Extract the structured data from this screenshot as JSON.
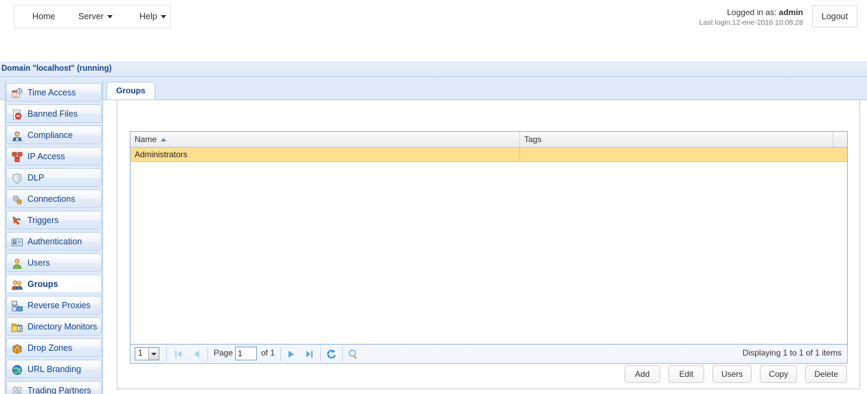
{
  "topnav": {
    "items": [
      {
        "label": "Home",
        "caret": false,
        "name": "nav-home"
      },
      {
        "label": "Server",
        "caret": true,
        "name": "nav-server"
      },
      {
        "label": "Help",
        "caret": true,
        "name": "nav-help"
      }
    ]
  },
  "session": {
    "logged_in_prefix": "Logged in as: ",
    "user": "admin",
    "last_login": "Last login:12-ene-2016 10:08:28",
    "logout_label": "Logout"
  },
  "domain": {
    "title": "Domain \"localhost\" (running)"
  },
  "sidebar": {
    "items": [
      {
        "label": "Time Access",
        "icon": "clock-calendar-icon",
        "active": false
      },
      {
        "label": "Banned Files",
        "icon": "banned-file-icon",
        "active": false
      },
      {
        "label": "Compliance",
        "icon": "officer-icon",
        "active": false
      },
      {
        "label": "IP Access",
        "icon": "network-blocks-icon",
        "active": false
      },
      {
        "label": "DLP",
        "icon": "shield-icon",
        "active": false
      },
      {
        "label": "Connections",
        "icon": "gears-icon",
        "active": false
      },
      {
        "label": "Triggers",
        "icon": "lightning-arrow-icon",
        "active": false
      },
      {
        "label": "Authentication",
        "icon": "id-card-icon",
        "active": false
      },
      {
        "label": "Users",
        "icon": "user-icon",
        "active": false
      },
      {
        "label": "Groups",
        "icon": "users-group-icon",
        "active": true
      },
      {
        "label": "Reverse Proxies",
        "icon": "proxy-nodes-icon",
        "active": false
      },
      {
        "label": "Directory Monitors",
        "icon": "folder-clock-icon",
        "active": false
      },
      {
        "label": "Drop Zones",
        "icon": "package-icon",
        "active": false
      },
      {
        "label": "URL Branding",
        "icon": "globe-icon",
        "active": false
      },
      {
        "label": "Trading Partners",
        "icon": "handshake-icon",
        "active": false
      }
    ]
  },
  "tabs": [
    {
      "label": "Groups",
      "active": true
    }
  ],
  "grid": {
    "columns": [
      "Name",
      "Tags"
    ],
    "sort": {
      "column": "Name",
      "direction": "asc"
    },
    "rows": [
      {
        "name": "Administrators",
        "tags": "",
        "selected": true
      }
    ]
  },
  "pager": {
    "page_size": "1",
    "page_label": "Page",
    "page_value": "1",
    "of_label": "of 1",
    "display_text": "Displaying 1 to 1 of 1 items",
    "buttons": {
      "first": "first-page-icon",
      "prev": "prev-page-icon",
      "next": "next-page-icon",
      "last": "last-page-icon",
      "refresh": "refresh-icon",
      "search": "search-icon"
    }
  },
  "actions": [
    {
      "label": "Add"
    },
    {
      "label": "Edit"
    },
    {
      "label": "Users"
    },
    {
      "label": "Copy"
    },
    {
      "label": "Delete"
    }
  ],
  "colors": {
    "accent": "#15428b",
    "selected_row": "#fddf8e",
    "domain_bar": "#e3eefb",
    "panel_border": "#c8c8c8"
  }
}
